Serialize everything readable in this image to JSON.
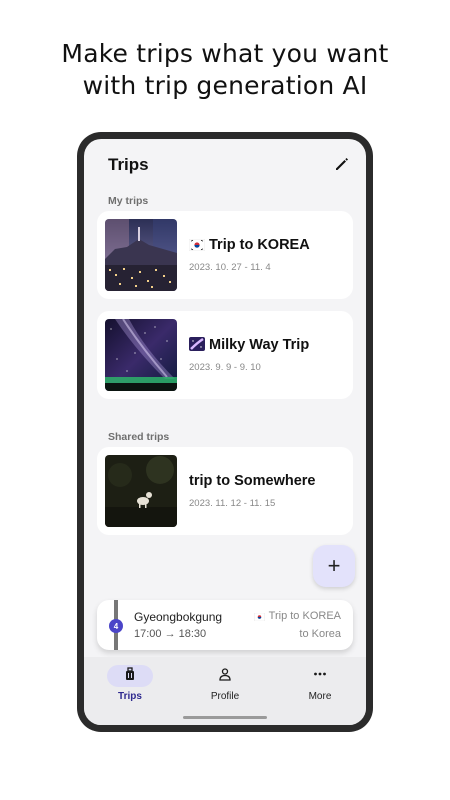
{
  "headline": {
    "line1": "Make trips what you want",
    "line2": "with trip generation AI"
  },
  "header": {
    "title": "Trips",
    "edit_icon": "pencil-icon"
  },
  "sections": {
    "my_trips": "My trips",
    "shared_trips": "Shared trips"
  },
  "my_trips": [
    {
      "icon": "korea-flag-icon",
      "title": "Trip to KOREA",
      "date": "2023. 10. 27 - 11. 4"
    },
    {
      "icon": "milky-way-icon",
      "title": "Milky Way Trip",
      "date": "2023. 9. 9 - 9. 10"
    }
  ],
  "shared_trips": [
    {
      "title": "trip to Somewhere",
      "date": "2023. 11. 12 - 11. 15"
    }
  ],
  "fab": {
    "label": "+"
  },
  "now_card": {
    "badge": "4",
    "place": "Gyeongbokgung",
    "time": "17:00 → 18:30",
    "trip": "Trip to KOREA",
    "destination": "to Korea"
  },
  "nav": {
    "items": [
      {
        "label": "Trips",
        "icon": "luggage-icon",
        "active": true
      },
      {
        "label": "Profile",
        "icon": "person-icon",
        "active": false
      },
      {
        "label": "More",
        "icon": "more-dots-icon",
        "active": false
      }
    ]
  },
  "colors": {
    "accent": "#4b45c8",
    "active_nav_bg": "#dddcf6",
    "fab_bg": "#e3e2fb",
    "screen_bg": "#f4f4f6"
  }
}
